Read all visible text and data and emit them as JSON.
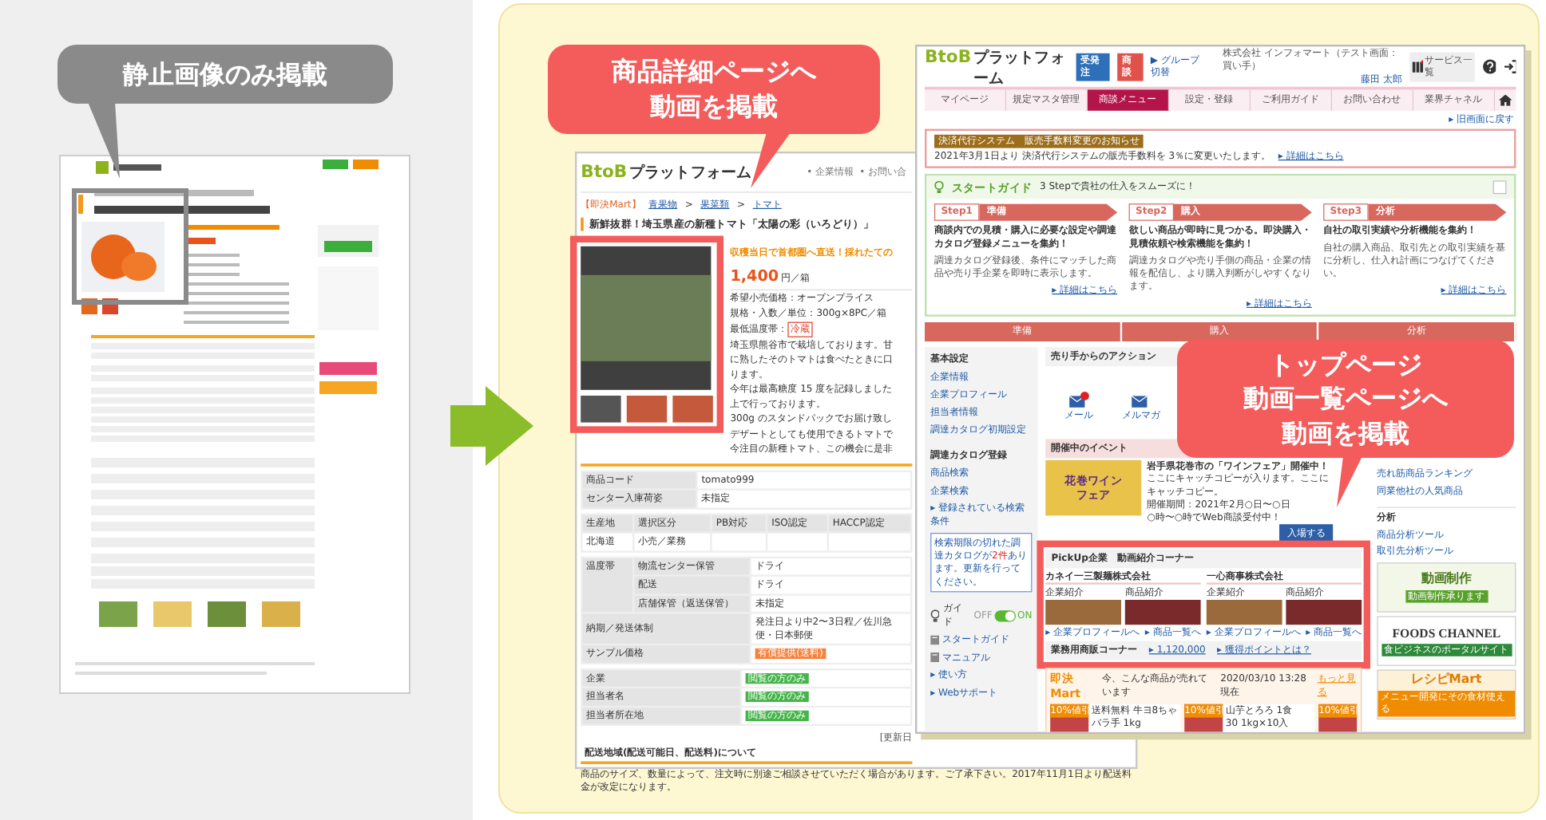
{
  "left_panel": {
    "callout": [
      "静止画像のみ掲載"
    ]
  },
  "middle": {
    "callout": [
      "商品詳細ページへ",
      "動画を掲載"
    ],
    "page": {
      "logo": {
        "mark": "BtoB",
        "name": "プラットフォーム"
      },
      "header_links": [
        "• 企業情報",
        "• お問い合"
      ],
      "breadcrumb": [
        {
          "kind": "tag",
          "text": "【即決Mart】"
        },
        {
          "kind": "link",
          "text": "青果物"
        },
        {
          "kind": "sep",
          "text": ">"
        },
        {
          "kind": "link",
          "text": "果菜類"
        },
        {
          "kind": "sep",
          "text": ">"
        },
        {
          "kind": "link",
          "text": "トマト"
        }
      ],
      "title": "新鮮抜群！埼玉県産の新種トマト「太陽の彩（いろどり）」",
      "tagline": "収穫当日で首都圏へ直送！採れたての",
      "price": "1,400",
      "price_unit": "円／箱",
      "specs": [
        "希望小売価格：オープンプライス",
        "規格・入数／単位：300g×8PC／箱"
      ],
      "temp_label": "最低温度帯：",
      "temp_badge": "冷蔵",
      "description": [
        "埼玉県熊谷市で栽培しております。甘",
        "に熟したそのトマトは食べたときに口",
        "ります。",
        "今年は最高糖度 15 度を記録しました",
        "上で行っております。",
        "300g のスタンドパックでお届け致し",
        "デザートとしても使用できるトマトで",
        "今注目の新種トマト、この機会に是非"
      ],
      "code_table": [
        [
          "商品コード",
          "tomato999"
        ],
        [
          "センター入庫荷姿",
          "未指定"
        ]
      ],
      "origin_table": {
        "columns": [
          "生産地",
          "選択区分",
          "PB対応",
          "ISO認定",
          "HACCP認定"
        ],
        "row": [
          "北海道",
          "小売／業務"
        ]
      },
      "temp_group": {
        "label": "温度帯",
        "rows": [
          [
            "物流センター保管",
            "ドライ"
          ],
          [
            "配送",
            "ドライ"
          ],
          [
            "店舗保管（返送保管）",
            "未指定"
          ]
        ]
      },
      "detail_rows": [
        {
          "label": "納期／発送体制",
          "kind": "text",
          "value": "発注日より中2〜3日程／佐川急便・日本郵便"
        },
        {
          "label": "サンプル価格",
          "kind": "orange",
          "value": "有償提供(送料)"
        }
      ],
      "contact_rows": [
        {
          "label": "企業",
          "kind": "green",
          "value": "閲覧の方のみ"
        },
        {
          "label": "担当者名",
          "kind": "green",
          "value": "閲覧の方のみ"
        },
        {
          "label": "担当者所在地",
          "kind": "green",
          "value": "閲覧の方のみ"
        }
      ],
      "updated": "[更新日",
      "shipping_heading": "配送地域(配送可能日、配送料)について",
      "shipping_note": "商品のサイズ、数量によって、注文時に別途ご相談させていただく場合があります。ご了承下さい。2017年11月1日より配送料金が改定になります。"
    }
  },
  "right": {
    "callout": [
      "トップページ",
      "動画一覧ページへ",
      "動画を掲載"
    ],
    "page": {
      "logo": {
        "mark": "BtoB",
        "name": "プラットフォーム"
      },
      "modes": [
        {
          "label": "受発注",
          "kind": "blue"
        },
        {
          "label": "商談",
          "kind": "red"
        }
      ],
      "group_switch": "▶ グループ切替",
      "company": "株式会社 インフォマート（テスト画面：買い手）",
      "user": "藤田 太郎",
      "services_label": "サービス一覧",
      "nav": [
        {
          "label": "マイページ",
          "selected": false
        },
        {
          "label": "規定マスタ管理",
          "selected": false
        },
        {
          "label": "商談メニュー",
          "selected": true
        },
        {
          "label": "設定・登録",
          "selected": false
        },
        {
          "label": "ご利用ガイド",
          "selected": false
        },
        {
          "label": "お問い合わせ",
          "selected": false
        },
        {
          "label": "業界チャネル",
          "selected": false
        }
      ],
      "back_link": "▸ 旧画面に戻す",
      "notice": {
        "tag": "決済代行システム　販売手数料変更のお知らせ",
        "text": "2021年3月1日より 決済代行システムの販売手数料を 3％に変更いたします。",
        "link": "▸ 詳細はこちら"
      },
      "guide": {
        "title": "スタートガイド",
        "subtitle": "3 Stepで貴社の仕入をスムーズに！",
        "steps": [
          {
            "step": "Step1",
            "name": "準備",
            "headline": "商談内での見積・購入に必要な設定や調達カタログ登録メニューを集約！",
            "text": "調達カタログ登録後、条件にマッチした商品や売り手企業を即時に表示します。",
            "link": "▸ 詳細はこちら"
          },
          {
            "step": "Step2",
            "name": "購入",
            "headline": "欲しい商品が即時に見つかる。即決購入・見積依頼や検索機能を集約！",
            "text": "調達カタログや売り手側の商品・企業の情報を配信し、より購入判断がしやすくなります。",
            "link": "▸ 詳細はこちら"
          },
          {
            "step": "Step3",
            "name": "分析",
            "headline": "自社の取引実績や分析機能を集約！",
            "text": "自社の購入商品、取引先との取引実績を基に分析し、仕入れ計画につなげてください。",
            "link": "▸ 詳細はこちら"
          }
        ]
      },
      "flow": [
        "準備",
        "購入",
        "分析"
      ],
      "menu": [
        {
          "kind": "heading",
          "label": "基本設定"
        },
        {
          "kind": "link",
          "label": "企業情報"
        },
        {
          "kind": "link",
          "label": "企業プロフィール"
        },
        {
          "kind": "link",
          "label": "担当者情報"
        },
        {
          "kind": "link",
          "label": "調達カタログ初期設定"
        },
        {
          "kind": "heading",
          "label": "調達カタログ登録"
        },
        {
          "kind": "link",
          "label": "商品検索"
        },
        {
          "kind": "link",
          "label": "企業検索"
        },
        {
          "kind": "link",
          "label": "▸ 登録されている検索条件"
        }
      ],
      "tooltip": {
        "before": "検索期限の切れた調達カタログが",
        "count": "2件",
        "after": "あります。更新を行ってください。"
      },
      "guide_toggle": {
        "label": "ガイド",
        "off_label": "OFF",
        "on_label": "ON",
        "on": true
      },
      "help_links": [
        {
          "kind": "icon",
          "label": "スタートガイド"
        },
        {
          "kind": "icon",
          "label": "マニュアル"
        },
        {
          "kind": "arrow",
          "label": "▸ 使い方"
        },
        {
          "kind": "arrow",
          "label": "▸ Webサポート"
        }
      ],
      "actions": {
        "title": "売り手からのアクション",
        "items": [
          {
            "label": "メール",
            "unread": true
          },
          {
            "label": "メルマガ",
            "unread": false
          }
        ]
      },
      "events": {
        "title": "開催中のイベント",
        "banner": [
          "花巻ワイン",
          "フェア"
        ],
        "headline": "岩手県花巻市の「ワインフェア」開催中！",
        "copy": "ここにキャッチコピーが入ります。ここにキャッチコピー。",
        "period": "開催期間：2021年2月○日〜○日",
        "hours": "○時〜○時でWeb商談受付中！",
        "button": "入場する"
      },
      "pickup": {
        "title": "PickUp企業　動画紹介コーナー",
        "companies": [
          {
            "name": "カネイ一三製麺株式会社",
            "videos": [
              "企業紹介",
              "商品紹介"
            ],
            "links": [
              "▸ 企業プロフィールへ",
              "▸ 商品一覧へ"
            ]
          },
          {
            "name": "一心商事株式会社",
            "videos": [
              "企業紹介",
              "商品紹介"
            ],
            "links": [
              "▸ 企業プロフィールへ",
              "▸ 商品一覧へ"
            ]
          }
        ]
      },
      "points": {
        "title": "業務用商販コーナー",
        "value": "▸ 1,120,000",
        "link": "▸ 獲得ポイントとは？"
      },
      "mart": {
        "title": "即決Mart",
        "tagline": "今、こんな商品が売れています",
        "time": "2020/03/10 13:28 現在",
        "more": "もっと見る",
        "products": [
          {
            "badge": "10%値引",
            "name_lines": [
              "送料無料 牛ヨ8ちゃ",
              "バラ手 1kg"
            ]
          },
          {
            "badge": "10%値引",
            "name_lines": [
              "山芋とろろ 1食",
              "30 1kg×10入"
            ]
          },
          {
            "badge": "10%値引"
          }
        ]
      },
      "side": {
        "ranking": [
          "売れ筋商品ランキング",
          "同業他社の人気商品"
        ],
        "analysis_title": "分析",
        "analysis": [
          "商品分析ツール",
          "取引先分析ツール"
        ],
        "banners": [
          {
            "kind": "video",
            "title": "動画制作",
            "caption": "動画制作承ります"
          },
          {
            "kind": "foods",
            "title": "FOODS CHANNEL",
            "caption": "食ビジネスのポータルサイト"
          },
          {
            "kind": "recipe",
            "title": "レシピMart",
            "caption": "メニュー開発にその食材使える"
          }
        ]
      }
    }
  }
}
